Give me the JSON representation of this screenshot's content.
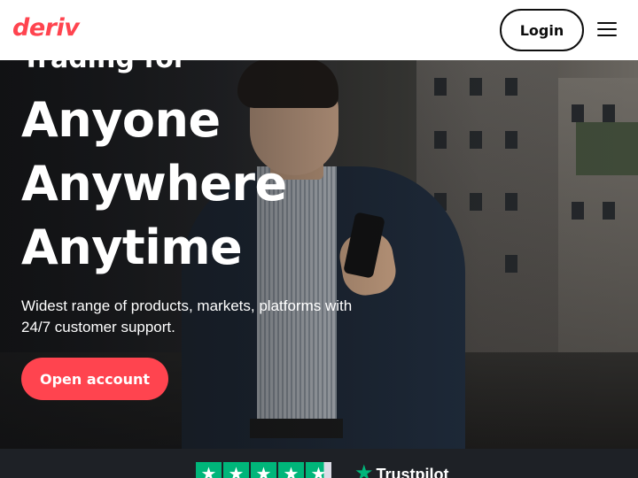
{
  "header": {
    "logo_text": "deriv",
    "login_label": "Login",
    "menu_icon": "hamburger-menu-icon"
  },
  "hero": {
    "pretitle": "Trading for",
    "lines": [
      "Anyone",
      "Anywhere",
      "Anytime"
    ],
    "subtitle": "Widest range of products, markets, platforms with 24/7 customer support.",
    "cta_label": "Open account"
  },
  "trust": {
    "brand": "Trustpilot",
    "star_icon": "trustpilot-star-icon",
    "rating_stars": 4.7
  },
  "colors": {
    "brand_red": "#ff444f",
    "trustpilot_green": "#00b67a",
    "dark_bg": "#0e0f11"
  }
}
